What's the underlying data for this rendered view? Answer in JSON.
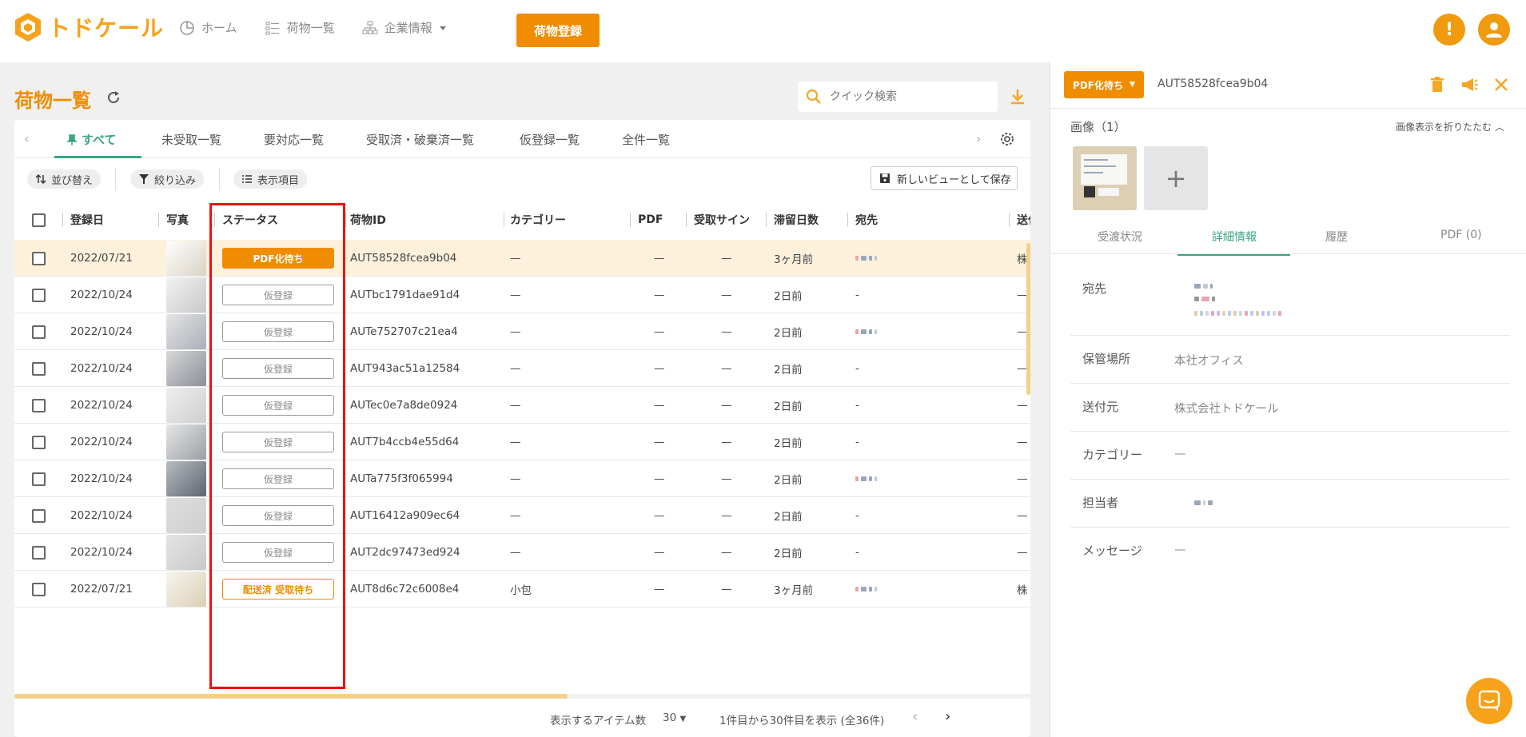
{
  "app": {
    "logo_text": "トドケール",
    "nav": {
      "home": "ホーム",
      "parcels": "荷物一覧",
      "company": "企業情報"
    },
    "register_label": "荷物登録",
    "alert_glyph": "!"
  },
  "list": {
    "title": "荷物一覧",
    "search_placeholder": "クイック検索",
    "tabs": [
      "すべて",
      "未受取一覧",
      "要対応一覧",
      "受取済・破棄済一覧",
      "仮登録一覧",
      "全件一覧"
    ],
    "toolbar": {
      "sort": "並び替え",
      "filter": "絞り込み",
      "columns": "表示項目",
      "save_view": "新しいビューとして保存"
    },
    "columns": [
      "登録日",
      "写真",
      "ステータス",
      "荷物ID",
      "カテゴリー",
      "PDF",
      "受取サイン",
      "滞留日数",
      "宛先",
      "送付"
    ],
    "rows": [
      {
        "date": "2022/07/21",
        "status": "PDF化待ち",
        "status_type": "pdf",
        "id": "AUT58528fcea9b04",
        "category": "—",
        "pdf": "—",
        "sign": "—",
        "days": "3ヶ月前",
        "to": "",
        "from": "株",
        "highlight": true
      },
      {
        "date": "2022/10/24",
        "status": "仮登録",
        "status_type": "temp",
        "id": "AUTbc1791dae91d4",
        "category": "—",
        "pdf": "—",
        "sign": "—",
        "days": "2日前",
        "to": "-",
        "from": "—"
      },
      {
        "date": "2022/10/24",
        "status": "仮登録",
        "status_type": "temp",
        "id": "AUTe752707c21ea4",
        "category": "—",
        "pdf": "—",
        "sign": "—",
        "days": "2日前",
        "to": "",
        "from": "—"
      },
      {
        "date": "2022/10/24",
        "status": "仮登録",
        "status_type": "temp",
        "id": "AUT943ac51a12584",
        "category": "—",
        "pdf": "—",
        "sign": "—",
        "days": "2日前",
        "to": "-",
        "from": "—"
      },
      {
        "date": "2022/10/24",
        "status": "仮登録",
        "status_type": "temp",
        "id": "AUTec0e7a8de0924",
        "category": "—",
        "pdf": "—",
        "sign": "—",
        "days": "2日前",
        "to": "-",
        "from": "—"
      },
      {
        "date": "2022/10/24",
        "status": "仮登録",
        "status_type": "temp",
        "id": "AUT7b4ccb4e55d64",
        "category": "—",
        "pdf": "—",
        "sign": "—",
        "days": "2日前",
        "to": "-",
        "from": "—"
      },
      {
        "date": "2022/10/24",
        "status": "仮登録",
        "status_type": "temp",
        "id": "AUTa775f3f065994",
        "category": "—",
        "pdf": "—",
        "sign": "—",
        "days": "2日前",
        "to": "",
        "from": "—"
      },
      {
        "date": "2022/10/24",
        "status": "仮登録",
        "status_type": "temp",
        "id": "AUT16412a909ec64",
        "category": "—",
        "pdf": "—",
        "sign": "—",
        "days": "2日前",
        "to": "-",
        "from": "—"
      },
      {
        "date": "2022/10/24",
        "status": "仮登録",
        "status_type": "temp",
        "id": "AUT2dc97473ed924",
        "category": "—",
        "pdf": "—",
        "sign": "—",
        "days": "2日前",
        "to": "-",
        "from": "—"
      },
      {
        "date": "2022/07/21",
        "status": "配送済 受取待ち",
        "status_type": "delivered",
        "id": "AUT8d6c72c6008e4",
        "category": "小包",
        "pdf": "—",
        "sign": "—",
        "days": "3ヶ月前",
        "to": "",
        "from": "株"
      }
    ],
    "pager": {
      "per_page_label": "表示するアイテム数",
      "per_page": "30",
      "range": "1件目から30件目を表示 (全36件)"
    }
  },
  "detail": {
    "status": "PDF化待ち",
    "id": "AUT58528fcea9b04",
    "images_label": "画像（1）",
    "collapse_label": "画像表示を折りたたむ",
    "add_glyph": "+",
    "tabs": [
      "受渡状況",
      "詳細情報",
      "履歴",
      "PDF (0)"
    ],
    "fields": [
      {
        "label": "宛先",
        "value": ""
      },
      {
        "label": "保管場所",
        "value": "本社オフィス"
      },
      {
        "label": "送付元",
        "value": "株式会社トドケール"
      },
      {
        "label": "カテゴリー",
        "value": "—"
      },
      {
        "label": "担当者",
        "value": ""
      },
      {
        "label": "メッセージ",
        "value": "—"
      }
    ]
  },
  "colors": {
    "accent": "#f08c00",
    "tab_active": "#3aa57e",
    "highlight_row": "#fdf1dc",
    "annotation_box": "#e11111"
  }
}
